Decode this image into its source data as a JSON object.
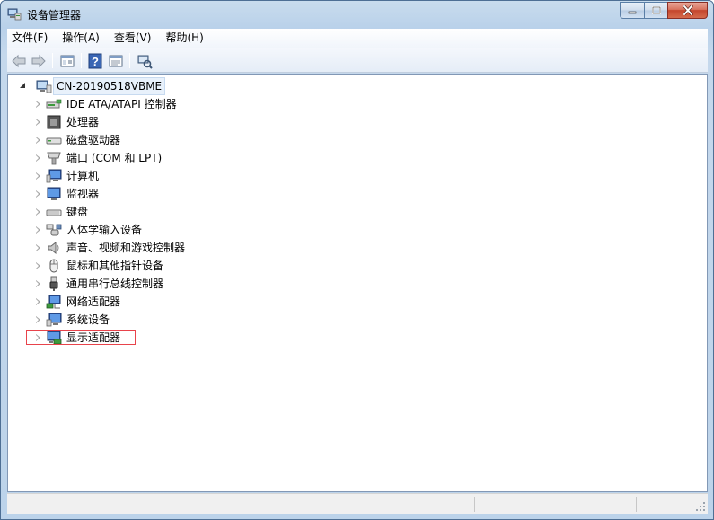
{
  "window": {
    "title": "设备管理器"
  },
  "menu": [
    {
      "label": "文件(F)"
    },
    {
      "label": "操作(A)"
    },
    {
      "label": "查看(V)"
    },
    {
      "label": "帮助(H)"
    }
  ],
  "toolbar": {
    "buttons": [
      "back-icon",
      "forward-icon",
      "show-hide-tree-icon",
      "help-icon",
      "properties-icon",
      "scan-hardware-icon"
    ]
  },
  "tree": {
    "root": {
      "label": "CN-20190518VBME",
      "expanded": true
    },
    "categories": [
      {
        "label": "IDE ATA/ATAPI 控制器",
        "icon": "ide-controller-icon"
      },
      {
        "label": "处理器",
        "icon": "processor-icon"
      },
      {
        "label": "磁盘驱动器",
        "icon": "disk-drive-icon"
      },
      {
        "label": "端口 (COM 和 LPT)",
        "icon": "port-icon"
      },
      {
        "label": "计算机",
        "icon": "computer-icon"
      },
      {
        "label": "监视器",
        "icon": "monitor-icon"
      },
      {
        "label": "键盘",
        "icon": "keyboard-icon"
      },
      {
        "label": "人体学输入设备",
        "icon": "hid-icon"
      },
      {
        "label": "声音、视频和游戏控制器",
        "icon": "sound-icon"
      },
      {
        "label": "鼠标和其他指针设备",
        "icon": "mouse-icon"
      },
      {
        "label": "通用串行总线控制器",
        "icon": "usb-icon"
      },
      {
        "label": "网络适配器",
        "icon": "network-adapter-icon"
      },
      {
        "label": "系统设备",
        "icon": "system-devices-icon"
      },
      {
        "label": "显示适配器",
        "icon": "display-adapter-icon",
        "highlighted": true
      }
    ]
  },
  "colors": {
    "highlight_border": "#e8434b",
    "title_gradient": "#c9dced",
    "selection_bg": "#e8f1fb"
  }
}
